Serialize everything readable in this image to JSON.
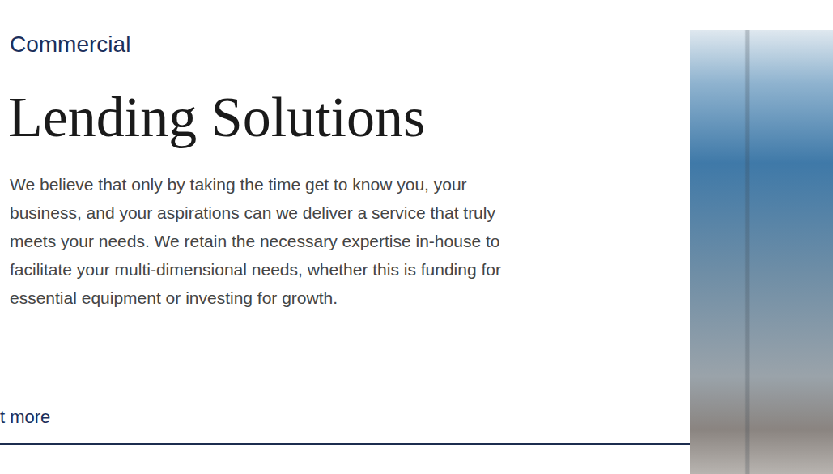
{
  "section": {
    "kicker": "Commercial",
    "title": "Lending Solutions",
    "body": "We believe that only by taking the time get to know you, your business, and your aspirations can we deliver a service that truly meets your needs. We retain the necessary expertise in-house to facilitate your multi-dimensional needs, whether this is funding for essential equipment or investing for growth.",
    "link": "t more"
  }
}
